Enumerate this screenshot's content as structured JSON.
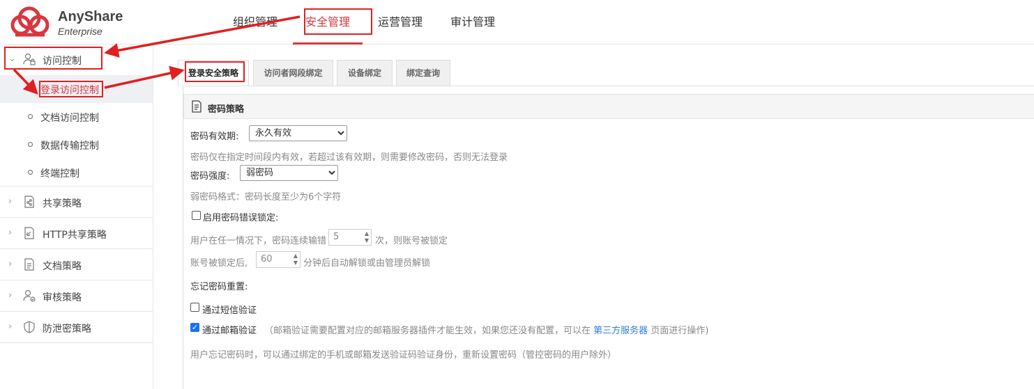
{
  "brand": {
    "name": "AnyShare",
    "edition": "Enterprise",
    "color": "#d9363e"
  },
  "topnav": {
    "tabs": [
      {
        "label": "组织管理",
        "active": false
      },
      {
        "label": "安全管理",
        "active": true
      },
      {
        "label": "运营管理",
        "active": false
      },
      {
        "label": "审计管理",
        "active": false
      }
    ]
  },
  "sidebar": {
    "access_control": {
      "label": "访问控制",
      "icon": "user-lock-icon",
      "expanded": true,
      "items": [
        {
          "label": "登录访问控制",
          "active": true
        },
        {
          "label": "文档访问控制",
          "active": false
        },
        {
          "label": "数据传输控制",
          "active": false
        },
        {
          "label": "终端控制",
          "active": false
        }
      ]
    },
    "groups": [
      {
        "label": "共享策略",
        "icon": "share-doc-icon"
      },
      {
        "label": "HTTP共享策略",
        "icon": "link-doc-icon"
      },
      {
        "label": "文档策略",
        "icon": "document-icon"
      },
      {
        "label": "审核策略",
        "icon": "user-check-icon"
      },
      {
        "label": "防泄密策略",
        "icon": "shield-icon"
      }
    ]
  },
  "subtabs": [
    {
      "label": "登录安全策略",
      "active": true
    },
    {
      "label": "访问者网段绑定",
      "active": false
    },
    {
      "label": "设备绑定",
      "active": false
    },
    {
      "label": "绑定查询",
      "active": false
    }
  ],
  "panel": {
    "title": "密码策略",
    "expiry_label": "密码有效期:",
    "expiry_value": "永久有效",
    "expiry_hint": "密码仅在指定时间段内有效，若超过该有效期，则需要修改密码，否则无法登录",
    "strength_label": "密码强度:",
    "strength_value": "弱密码",
    "strength_hint": "弱密码格式：密码长度至少为6个字符",
    "lockout_label": "启用密码错误锁定:",
    "lockout_checked": false,
    "lockout_text_1": "用户在任一情况下，密码连续输错",
    "lockout_attempts": "5",
    "lockout_text_2": "次，则账号被锁定",
    "unlock_text_1": "账号被锁定后,",
    "unlock_minutes": "60",
    "unlock_text_2": "分钟后自动解锁或由管理员解锁",
    "reset_label": "忘记密码重置:",
    "sms_label": "通过短信验证",
    "sms_checked": false,
    "email_label": "通过邮箱验证",
    "email_checked": true,
    "email_note_1": "（邮箱验证需要配置对应的邮箱服务器插件才能生效，如果您还没有配置，可以在",
    "email_note_link": "第三方服务器",
    "email_note_2": "页面进行操作)",
    "reset_hint": "用户忘记密码时，可以通过绑定的手机或邮箱发送验证码验证身份，重新设置密码（管控密码的用户除外）"
  },
  "annotation_color": "#e02020"
}
